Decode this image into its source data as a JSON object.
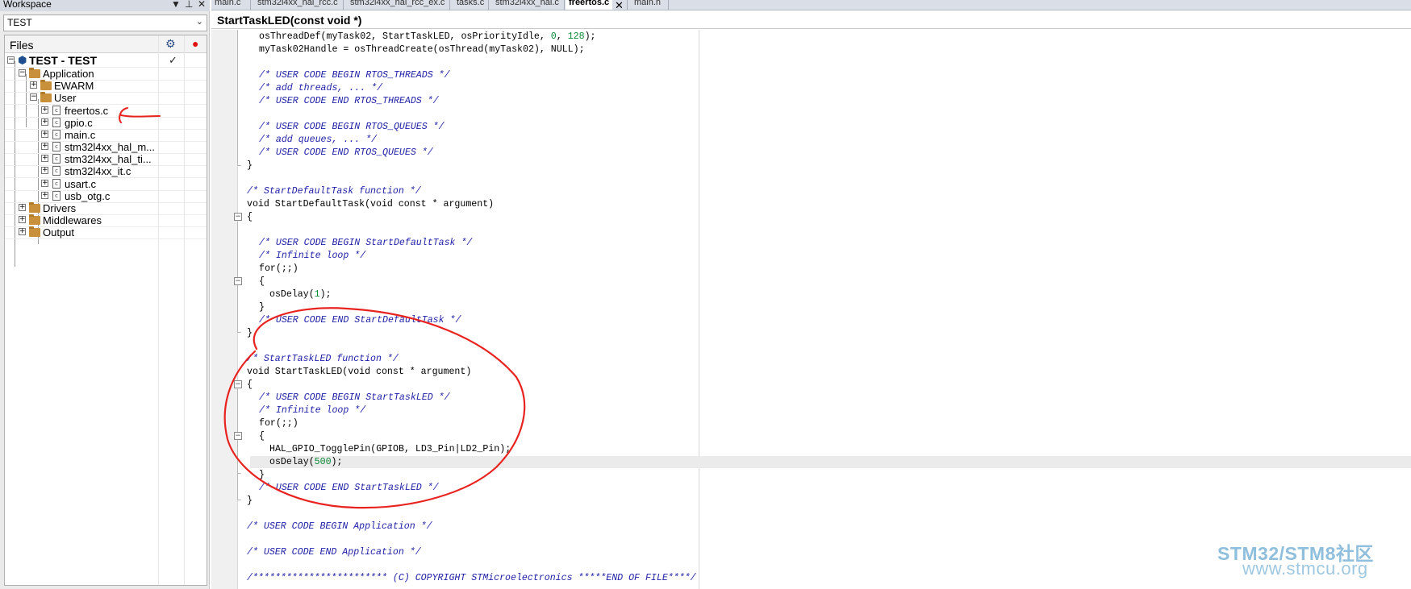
{
  "workspace": {
    "title": "Workspace",
    "pin_glyph": "▼",
    "pin2_glyph": "⊥",
    "close_glyph": "✕",
    "config": "TEST",
    "files_label": "Files",
    "tree": {
      "root": "TEST - TEST",
      "application": "Application",
      "ewarm": "EWARM",
      "user": "User",
      "files": [
        "freertos.c",
        "gpio.c",
        "main.c",
        "stm32l4xx_hal_m...",
        "stm32l4xx_hal_ti...",
        "stm32l4xx_it.c",
        "usart.c",
        "usb_otg.c"
      ],
      "drivers": "Drivers",
      "middlewares": "Middlewares",
      "output": "Output"
    }
  },
  "editor": {
    "tabs": [
      "main.c",
      "stm32l4xx_hal_rcc.c",
      "stm32l4xx_hal_rcc_ex.c",
      "tasks.c",
      "stm32l4xx_hal.c",
      "freertos.c",
      "main.h"
    ],
    "active_tab": "freertos.c",
    "close_glyph": "✕",
    "function_name": "StartTaskLED(const void *)"
  },
  "code": {
    "l01_a": "osThreadDef(myTask02, StartTaskLED, osPriorityIdle, ",
    "l01_n1": "0",
    "l01_b": ", ",
    "l01_n2": "128",
    "l01_c": ");",
    "l02": "myTask02Handle = osThreadCreate(osThread(myTask02), NULL);",
    "l04": "/* USER CODE BEGIN RTOS_THREADS */",
    "l05": "/* add threads, ... */",
    "l06": "/* USER CODE END RTOS_THREADS */",
    "l08": "/* USER CODE BEGIN RTOS_QUEUES */",
    "l09": "/* add queues, ... */",
    "l10": "/* USER CODE END RTOS_QUEUES */",
    "l11": "}",
    "l13": "/* StartDefaultTask function */",
    "l14": "void StartDefaultTask(void const * argument)",
    "l15": "{",
    "l17": "/* USER CODE BEGIN StartDefaultTask */",
    "l18": "/* Infinite loop */",
    "l19": "for(;;)",
    "l20": "{",
    "l21_a": "osDelay(",
    "l21_n": "1",
    "l21_b": ");",
    "l22": "}",
    "l23": "/* USER CODE END StartDefaultTask */",
    "l24": "}",
    "l26": "/* StartTaskLED function */",
    "l27": "void StartTaskLED(void const * argument)",
    "l28": "{",
    "l29": "/* USER CODE BEGIN StartTaskLED */",
    "l30": "/* Infinite loop */",
    "l31": "for(;;)",
    "l32": "{",
    "l33": "HAL_GPIO_TogglePin(GPIOB, LD3_Pin|LD2_Pin);",
    "l34_a": "osDelay(",
    "l34_n": "500",
    "l34_b": ");",
    "l35": "}",
    "l36": "/* USER CODE END StartTaskLED */",
    "l37": "}",
    "l39": "/* USER CODE BEGIN Application */",
    "l41": "/* USER CODE END Application */",
    "l43": "/************************ (C) COPYRIGHT STMicroelectronics *****END OF FILE****/"
  },
  "watermark": {
    "line1": "STM32/STM8社区",
    "line2": "www.stmcu.org"
  },
  "colors": {
    "comment": "#1f1fa8",
    "number": "#0a8a3a",
    "annotation": "#e8231f",
    "watermark": "#8fbfdc"
  },
  "icons": [
    "gear-icon",
    "record-dot-icon",
    "folder-icon",
    "file-icon",
    "project-icon",
    "check-icon",
    "expand-icon",
    "collapse-icon",
    "close-icon",
    "chevron-down-icon"
  ]
}
